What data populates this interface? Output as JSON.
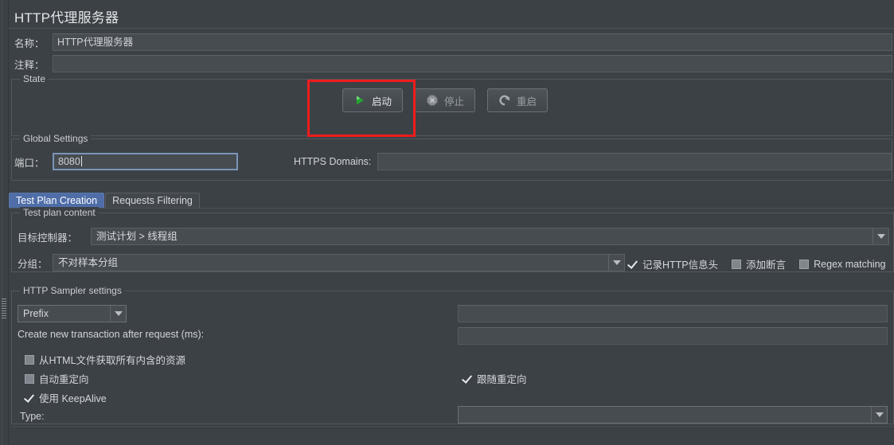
{
  "window": {
    "title": "HTTP代理服务器"
  },
  "form": {
    "name_label": "名称：",
    "name_value": "HTTP代理服务器",
    "comment_label": "注释：",
    "comment_value": ""
  },
  "state": {
    "group_title": "State",
    "buttons": [
      {
        "label": "启动",
        "icon": "play-icon",
        "enabled": true
      },
      {
        "label": "停止",
        "icon": "stop-icon",
        "enabled": false
      },
      {
        "label": "重启",
        "icon": "restart-icon",
        "enabled": false
      }
    ],
    "highlight_color": "#f01c1c"
  },
  "global_settings": {
    "group_title": "Global Settings",
    "port_label": "端口：",
    "port_value": "8080",
    "https_domains_label": "HTTPS Domains:",
    "https_domains_value": ""
  },
  "tabs": [
    {
      "label": "Test Plan Creation",
      "active": true
    },
    {
      "label": "Requests Filtering",
      "active": false
    }
  ],
  "test_plan_content": {
    "group_title": "Test plan content",
    "target_controller_label": "目标控制器：",
    "target_controller_value": "测试计划 > 线程组",
    "grouping_label": "分组：",
    "grouping_value": "不对样本分组",
    "checkboxes": [
      {
        "label": "记录HTTP信息头",
        "checked": true
      },
      {
        "label": "添加断言",
        "checked": false
      },
      {
        "label": "Regex matching",
        "checked": false
      }
    ]
  },
  "http_sampler_settings": {
    "group_title": "HTTP Sampler settings",
    "prefix_mode_value": "Prefix",
    "prefix_value": "",
    "transaction_label": "Create new transaction after request (ms):",
    "transaction_value": "",
    "checkboxes_left": [
      {
        "label": "从HTML文件获取所有内含的资源",
        "checked": false
      },
      {
        "label": "自动重定向",
        "checked": false
      },
      {
        "label": "使用 KeepAlive",
        "checked": true
      }
    ],
    "checkboxes_right": [
      {
        "label": "跟随重定向",
        "checked": true
      }
    ],
    "type_label": "Type:",
    "type_value": ""
  },
  "colors": {
    "background": "#3c4146",
    "field_bg": "#474c51",
    "accent_tab": "#4f6ea8",
    "play_green": "#26a832"
  }
}
